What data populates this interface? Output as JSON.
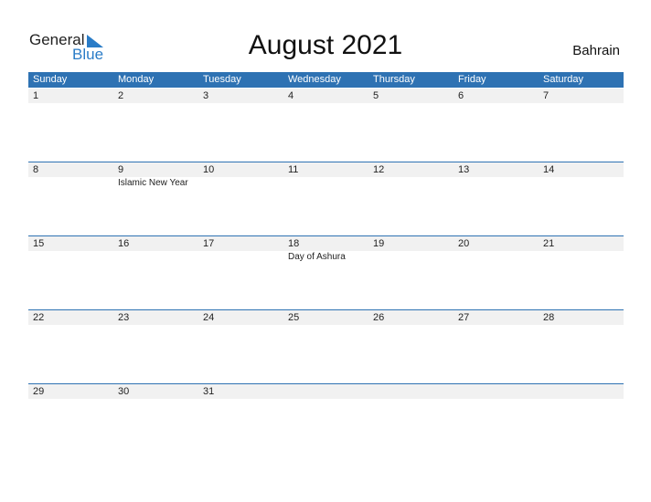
{
  "logo": {
    "general": "General",
    "blue": "Blue"
  },
  "title": "August 2021",
  "country": "Bahrain",
  "weekdays": [
    "Sunday",
    "Monday",
    "Tuesday",
    "Wednesday",
    "Thursday",
    "Friday",
    "Saturday"
  ],
  "weeks": [
    [
      {
        "d": "1"
      },
      {
        "d": "2"
      },
      {
        "d": "3"
      },
      {
        "d": "4"
      },
      {
        "d": "5"
      },
      {
        "d": "6"
      },
      {
        "d": "7"
      }
    ],
    [
      {
        "d": "8"
      },
      {
        "d": "9",
        "e": "Islamic New Year"
      },
      {
        "d": "10"
      },
      {
        "d": "11"
      },
      {
        "d": "12"
      },
      {
        "d": "13"
      },
      {
        "d": "14"
      }
    ],
    [
      {
        "d": "15"
      },
      {
        "d": "16"
      },
      {
        "d": "17"
      },
      {
        "d": "18",
        "e": "Day of Ashura"
      },
      {
        "d": "19"
      },
      {
        "d": "20"
      },
      {
        "d": "21"
      }
    ],
    [
      {
        "d": "22"
      },
      {
        "d": "23"
      },
      {
        "d": "24"
      },
      {
        "d": "25"
      },
      {
        "d": "26"
      },
      {
        "d": "27"
      },
      {
        "d": "28"
      }
    ],
    [
      {
        "d": "29"
      },
      {
        "d": "30"
      },
      {
        "d": "31"
      },
      {
        "d": ""
      },
      {
        "d": ""
      },
      {
        "d": ""
      },
      {
        "d": ""
      }
    ]
  ],
  "colors": {
    "accent": "#2e72b3",
    "band": "#f1f1f1"
  }
}
